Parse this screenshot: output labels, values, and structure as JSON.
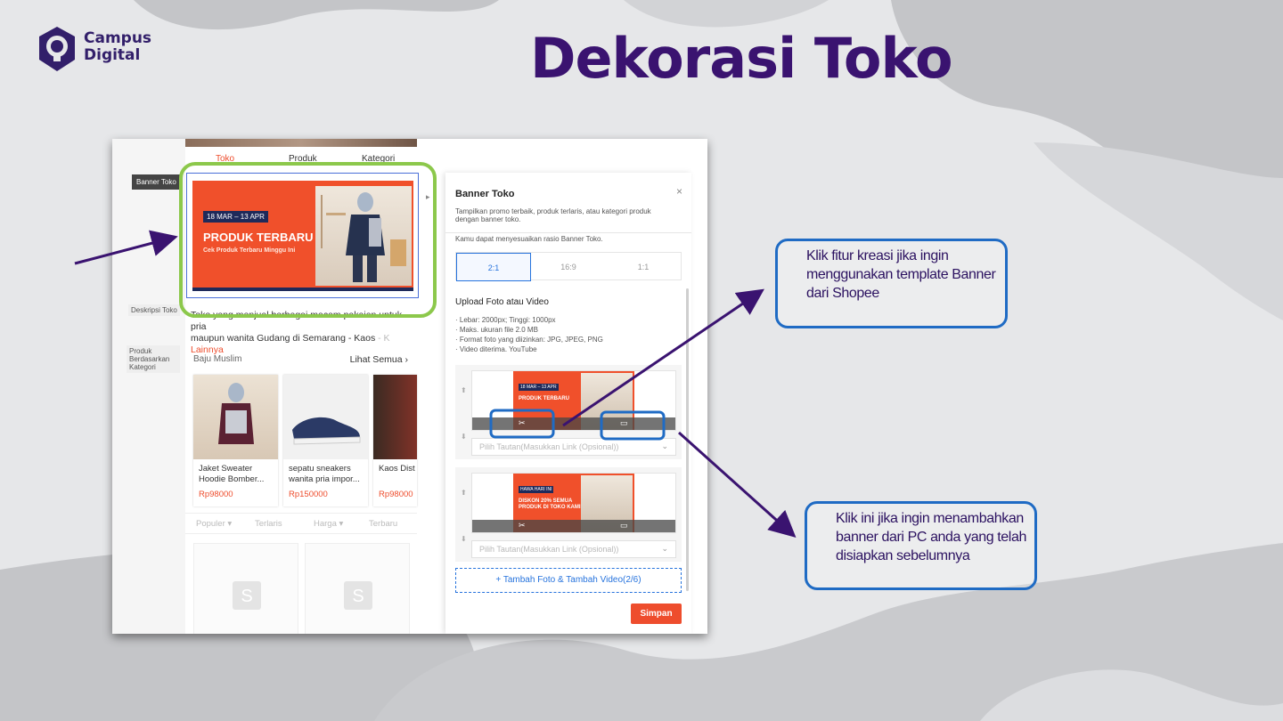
{
  "slide": {
    "title": "Dekorasi Toko",
    "logo_line1": "Campus",
    "logo_line2": "Digital"
  },
  "screenshot": {
    "left_rail": {
      "tag": "Banner Toko",
      "items": [
        "Deskripsi Toko",
        "Produk Berdasarkan Kategori"
      ]
    },
    "preview": {
      "tabs": [
        "Toko",
        "Produk",
        "Kategori"
      ],
      "banner": {
        "date": "18 MAR – 13 APR",
        "title": "PRODUK TERBARU",
        "subtitle": "Cek Produk Terbaru Minggu Ini"
      },
      "description": {
        "line1": "Toko yang menjual berbagai macam pakaian untuk pria",
        "line2": "maupun wanita Gudang di Semarang - Kaos",
        "faded": "- K",
        "more": "Lainnya"
      },
      "section": {
        "title": "Baju Muslim",
        "see_all": "Lihat Semua ›"
      },
      "products": [
        {
          "name": "Jaket Sweater Hoodie Bomber...",
          "price": "Rp98000"
        },
        {
          "name": "sepatu sneakers wanita pria impor...",
          "price": "Rp150000"
        },
        {
          "name": "Kaos Dist Kekinian I",
          "price": "Rp98000"
        }
      ],
      "sort": [
        "Populer ▾",
        "Terlaris",
        "Harga ▾",
        "Terbaru"
      ]
    },
    "panel": {
      "title": "Banner Toko",
      "close": "×",
      "description": "Tampilkan promo terbaik, produk terlaris, atau kategori produk dengan banner toko.",
      "ratio_note": "Kamu dapat menyesuaikan rasio Banner Toko.",
      "ratios": [
        "2:1",
        "16:9",
        "1:1"
      ],
      "selected_ratio": "2:1",
      "upload_title": "Upload Foto atau Video",
      "upload_rules": [
        "· Lebar: 2000px; Tinggi: 1000px",
        "· Maks. ukuran file 2.0 MB",
        "· Format foto yang diizinkan: JPG, JPEG, PNG",
        "· Video diterima. YouTube"
      ],
      "media": [
        {
          "thumb_tag": "18 MAR – 13 APR",
          "thumb_text": "PRODUK TERBARU",
          "link_placeholder": "Pilih Tautan(Masukkan Link (Opsional))"
        },
        {
          "thumb_tag": "HAWA HARI INI",
          "thumb_text": "DISKON 20% SEMUA PRODUK DI TOKO KAMI",
          "link_placeholder": "Pilih Tautan(Masukkan Link (Opsional))"
        }
      ],
      "add_media": "+ Tambah Foto & Tambah Video(2/6)",
      "save": "Simpan"
    }
  },
  "callouts": {
    "kreasi": "Klik fitur kreasi jika ingin menggunakan template Banner dari Shopee",
    "upload_pc": "Klik ini jika ingin menambahkan banner dari PC anda yang telah disiapkan sebelumnya"
  },
  "colors": {
    "title": "#3a1370",
    "callout_border": "#1f6bc4",
    "highlight_green": "#8cc84b",
    "arrow": "#3a1370",
    "shopee_orange": "#ee4d2d"
  }
}
